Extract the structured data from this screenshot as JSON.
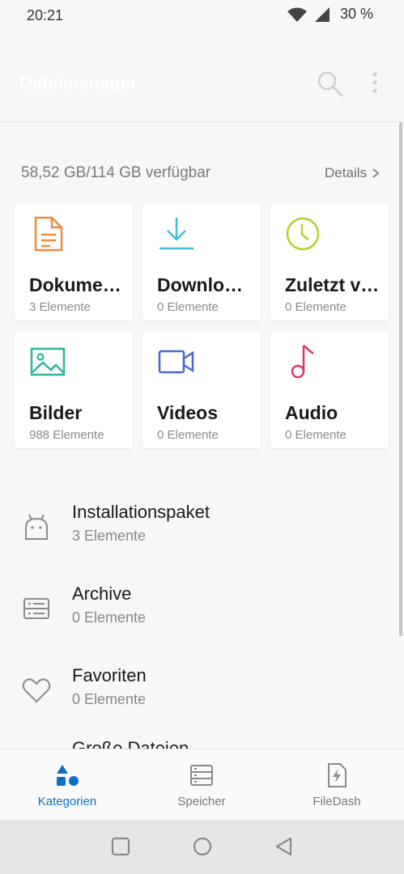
{
  "status_bar": {
    "time": "20:21",
    "battery": "30 %"
  },
  "app_bar": {
    "title": "Dateimanager"
  },
  "storage": {
    "summary": "58,52 GB/114 GB verfügbar",
    "details_label": "Details"
  },
  "categories": [
    {
      "title": "Dokume…",
      "count": "3 Elemente",
      "icon": "document-icon",
      "color": "#f08a3c"
    },
    {
      "title": "Downlo…",
      "count": "0 Elemente",
      "icon": "download-icon",
      "color": "#3bbfd0"
    },
    {
      "title": "Zuletzt v…",
      "count": "0 Elemente",
      "icon": "clock-icon",
      "color": "#bccd2a"
    },
    {
      "title": "Bilder",
      "count": "988 Elemente",
      "icon": "image-icon",
      "color": "#2fb39a"
    },
    {
      "title": "Videos",
      "count": "0 Elemente",
      "icon": "video-icon",
      "color": "#4a67d6"
    },
    {
      "title": "Audio",
      "count": "0 Elemente",
      "icon": "music-note-icon",
      "color": "#e0336c"
    }
  ],
  "list_items": [
    {
      "title": "Installationspaket",
      "count": "3 Elemente",
      "icon": "android-icon"
    },
    {
      "title": "Archive",
      "count": "0 Elemente",
      "icon": "archive-icon"
    },
    {
      "title": "Favoriten",
      "count": "0 Elemente",
      "icon": "heart-icon"
    }
  ],
  "partial_item": {
    "title": "Große Dateien"
  },
  "bottom_nav": {
    "tabs": [
      {
        "label": "Kategorien",
        "icon": "categories-icon",
        "active": true
      },
      {
        "label": "Speicher",
        "icon": "storage-icon",
        "active": false
      },
      {
        "label": "FileDash",
        "icon": "filedash-icon",
        "active": false
      }
    ]
  },
  "colors": {
    "accent": "#0b6fc6",
    "background": "#f7f7f7"
  }
}
